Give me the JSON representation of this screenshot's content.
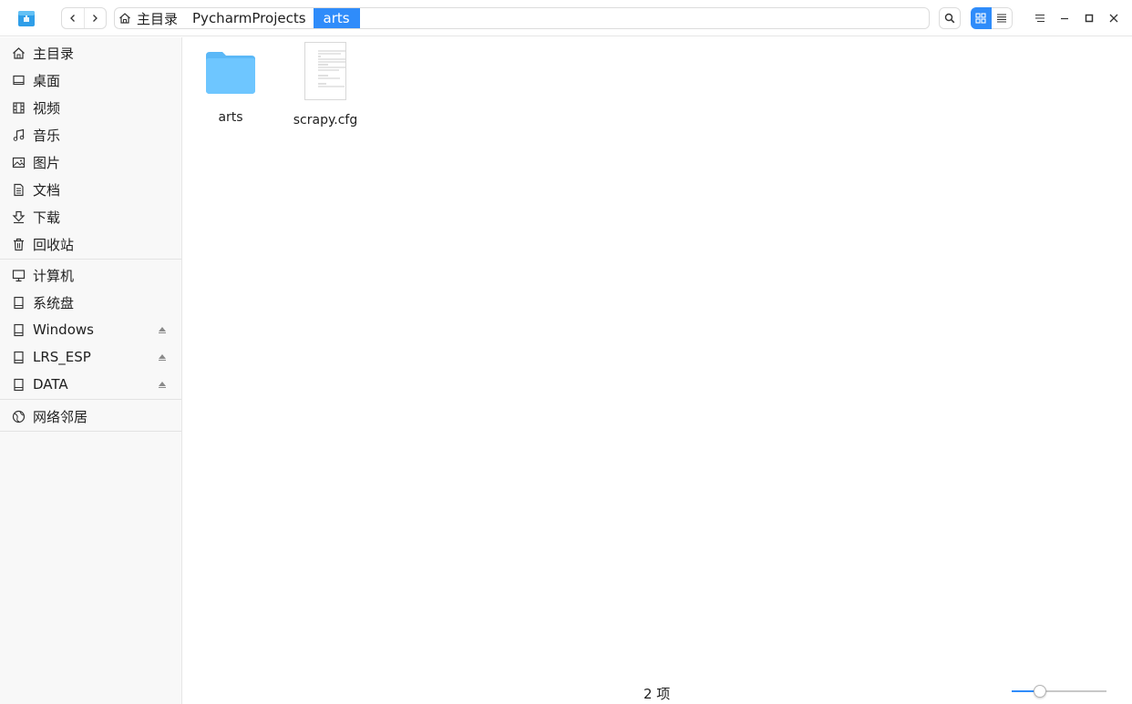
{
  "titlebar": {
    "breadcrumb": {
      "home": "主目录",
      "items": [
        "PycharmProjects",
        "arts"
      ]
    }
  },
  "sidebar": {
    "group1": [
      {
        "label": "主目录",
        "icon": "home-icon"
      },
      {
        "label": "桌面",
        "icon": "desktop-icon"
      },
      {
        "label": "视频",
        "icon": "video-icon"
      },
      {
        "label": "音乐",
        "icon": "music-icon"
      },
      {
        "label": "图片",
        "icon": "picture-icon"
      },
      {
        "label": "文档",
        "icon": "document-icon"
      },
      {
        "label": "下载",
        "icon": "download-icon"
      },
      {
        "label": "回收站",
        "icon": "trash-icon"
      }
    ],
    "group2": [
      {
        "label": "计算机",
        "icon": "computer-icon"
      },
      {
        "label": "系统盘",
        "icon": "disk-icon"
      },
      {
        "label": "Windows",
        "icon": "disk-icon",
        "eject": true
      },
      {
        "label": "LRS_ESP",
        "icon": "disk-icon",
        "eject": true
      },
      {
        "label": "DATA",
        "icon": "disk-icon",
        "eject": true
      }
    ],
    "group3": [
      {
        "label": "网络邻居",
        "icon": "network-icon"
      }
    ]
  },
  "files": [
    {
      "name": "arts",
      "type": "folder"
    },
    {
      "name": "scrapy.cfg",
      "type": "file"
    }
  ],
  "status": {
    "count_text": "2 项",
    "zoom_level": 0.27
  },
  "colors": {
    "accent": "#2f8cfa",
    "folder": "#6ec6ff"
  }
}
